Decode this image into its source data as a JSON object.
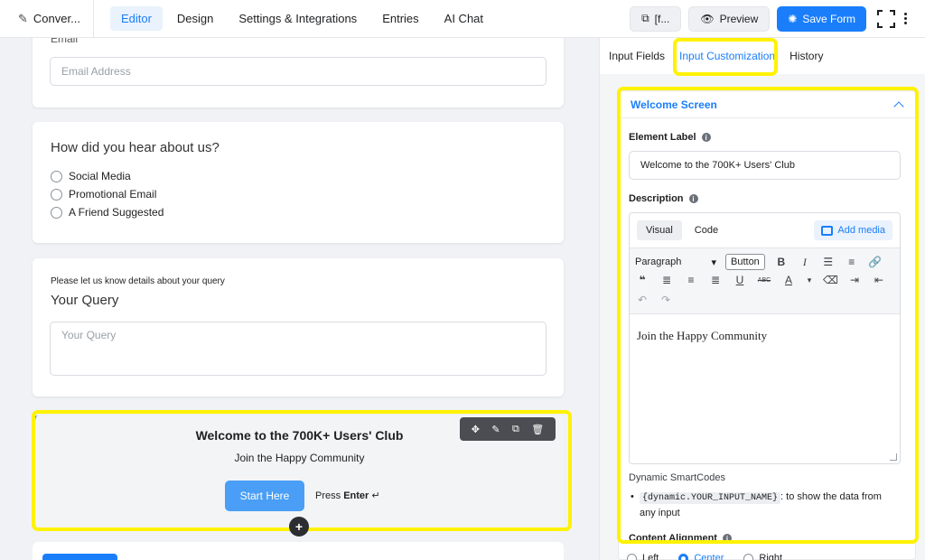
{
  "header": {
    "brand_title": "Conver...",
    "nav": [
      {
        "label": "Editor",
        "active": true
      },
      {
        "label": "Design",
        "active": false
      },
      {
        "label": "Settings & Integrations",
        "active": false
      },
      {
        "label": "Entries",
        "active": false
      },
      {
        "label": "AI Chat",
        "active": false
      }
    ],
    "shortcode_label": "[f...",
    "preview_label": "Preview",
    "save_label": "Save Form"
  },
  "canvas": {
    "email": {
      "label": "Email",
      "placeholder": "Email Address"
    },
    "hear_about": {
      "question": "How did you hear about us?",
      "options": [
        "Social Media",
        "Promotional Email",
        "A Friend Suggested"
      ]
    },
    "query": {
      "help": "Please let us know details about your query",
      "question": "Your Query",
      "placeholder": "Your Query"
    },
    "welcome": {
      "title": "Welcome to the 700K+ Users' Club",
      "description": "Join the Happy Community",
      "button": "Start Here",
      "press_prefix": "Press",
      "press_key": "Enter",
      "press_symbol": "↵"
    },
    "toolbar_icons": [
      "move-icon",
      "edit-icon",
      "duplicate-icon",
      "trash-icon"
    ]
  },
  "panel": {
    "tabs": [
      {
        "label": "Input Fields",
        "active": false
      },
      {
        "label": "Input Customization",
        "active": true
      },
      {
        "label": "History",
        "active": false
      }
    ],
    "section_title": "Welcome Screen",
    "element_label_title": "Element Label",
    "element_label_value": "Welcome to the 700K+ Users' Club",
    "description_title": "Description",
    "editor": {
      "tab_visual": "Visual",
      "tab_code": "Code",
      "add_media": "Add media",
      "format_select": "Paragraph",
      "button_label": "Button",
      "content": "Join the Happy Community"
    },
    "smartcodes_title": "Dynamic SmartCodes",
    "smartcode_code": "{dynamic.YOUR_INPUT_NAME}",
    "smartcode_text": ": to show the data from any input",
    "content_alignment_title": "Content Alignment",
    "alignment_options": [
      {
        "label": "Left",
        "selected": false
      },
      {
        "label": "Center",
        "selected": true
      },
      {
        "label": "Right",
        "selected": false
      }
    ]
  },
  "colors": {
    "accent": "#1a7efb",
    "highlight": "#fff200"
  }
}
